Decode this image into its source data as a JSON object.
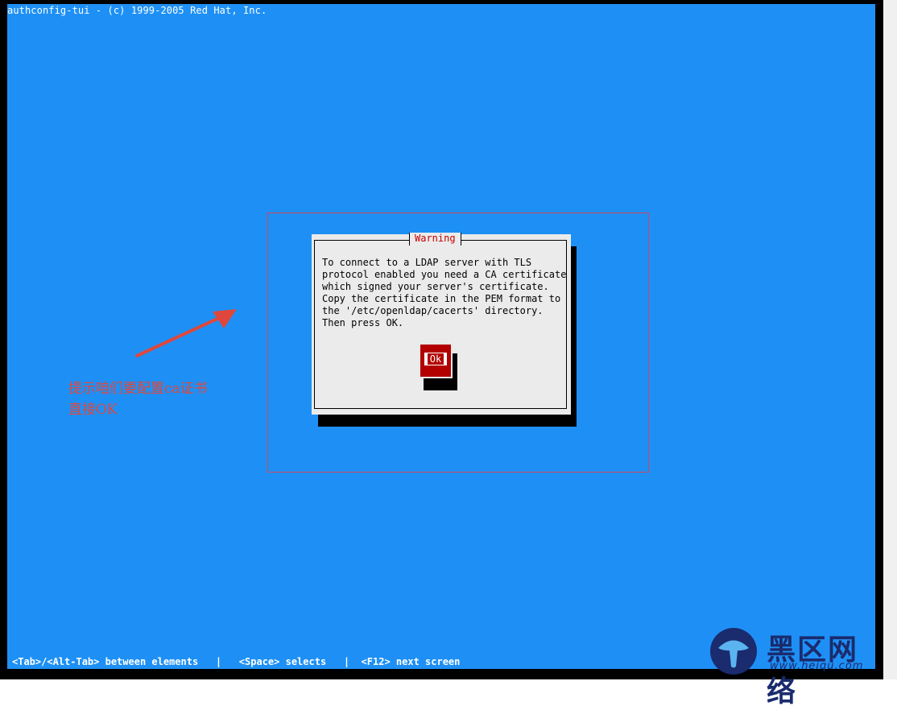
{
  "terminal": {
    "title": "authconfig-tui - (c) 1999-2005 Red Hat, Inc.",
    "help": {
      "tab": "<Tab>/<Alt-Tab> between elements",
      "space": "<Space> selects",
      "f12": "<F12> next screen",
      "separator": "|"
    }
  },
  "dialog": {
    "title": "Warning",
    "message": "To connect to a LDAP server with TLS\nprotocol enabled you need a CA certificate\nwhich signed your server's certificate.\nCopy the certificate in the PEM format to\nthe '/etc/openldap/cacerts' directory.\nThen press OK.",
    "ok_label": "Ok"
  },
  "annotation": {
    "line1": "提示咱们要配置ca证书",
    "line2": "直接OK"
  },
  "watermark": {
    "name": "黑区网络",
    "url": "www.heiqu.com"
  },
  "colors": {
    "screen_bg": "#1e90f5",
    "dialog_bg": "#ebebeb",
    "button_red": "#b30000",
    "annotation_red": "#e0473c"
  }
}
